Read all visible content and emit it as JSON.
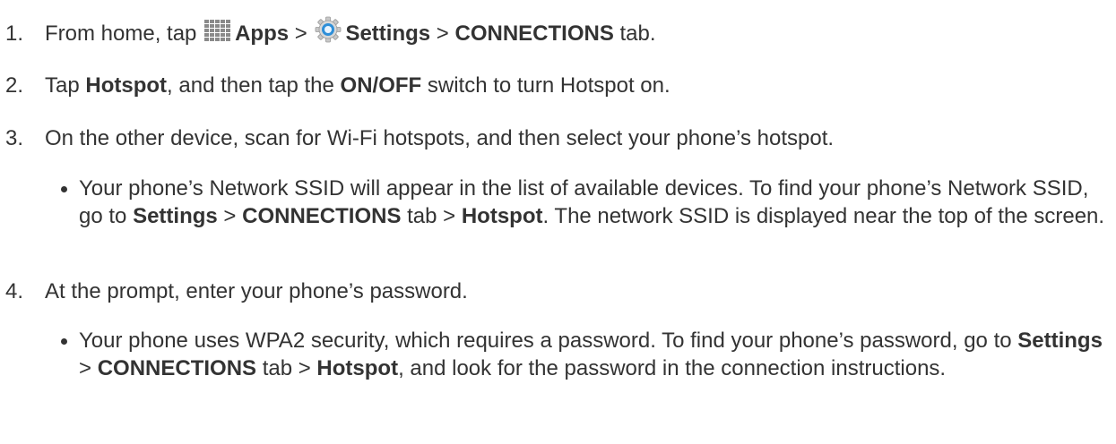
{
  "steps": [
    {
      "number": "1.",
      "text_a": "From home, tap",
      "apps_icon": "apps-grid-icon",
      "apps": "Apps",
      "sep1": ">",
      "settings_icon": "settings-gear-icon",
      "settings": "Settings",
      "sep2": ">",
      "connections": "CONNECTIONS",
      "text_b": "tab."
    },
    {
      "number": "2.",
      "text_a": "Tap",
      "hotspot": "Hotspot",
      "text_b": ", and then tap the",
      "onoff": "ON/OFF",
      "text_c": "switch to turn Hotspot on."
    },
    {
      "number": "3.",
      "text": "On the other device, scan for Wi-Fi hotspots, and then select your phone’s hotspot.",
      "bullet": {
        "text_a": "Your phone’s Network SSID will appear in the list of available devices. To find your phone’s Network SSID, go to",
        "settings": "Settings",
        "sep1": ">",
        "connections": "CONNECTIONS",
        "text_b": "tab >",
        "hotspot": "Hotspot",
        "text_c": ". The network SSID is displayed near the top of the screen."
      }
    },
    {
      "number": "4.",
      "text": "At the prompt, enter your phone’s password.",
      "bullet": {
        "text_a": "Your phone uses WPA2 security, which requires a password. To find your phone’s password, go to",
        "settings": "Settings",
        "sep1": ">",
        "connections": "CONNECTIONS",
        "text_b": "tab >",
        "hotspot": "Hotspot",
        "text_c": ", and look for the password in the connection instructions."
      }
    }
  ],
  "colors": {
    "text": "#333333",
    "apps_icon": "#7f7f7f",
    "settings_icon_ring": "#2f8fd8"
  }
}
